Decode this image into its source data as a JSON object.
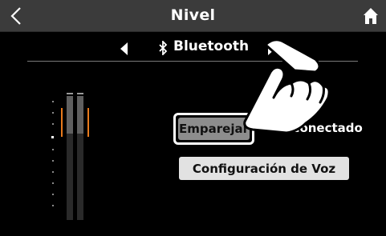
{
  "header": {
    "title": "Nivel",
    "back_icon": "chevron-left-icon",
    "home_icon": "home-icon"
  },
  "source": {
    "label": "Bluetooth",
    "icon": "bluetooth-icon",
    "prev_icon": "triangle-left-icon",
    "next_icon": "triangle-right-icon"
  },
  "bluetooth": {
    "pair_label": "Emparejar",
    "status": "Desconectado",
    "voice_label": "Configuración de Voz"
  },
  "meters": {
    "left_level": 0.3,
    "right_level": 0.3,
    "lit_color": "#5f5f5f",
    "peak_color": "#e87a1c"
  },
  "colors": {
    "background": "#000000",
    "topbar": "#3b3b3b",
    "button_light": "#e2e2e2",
    "button_selected": "#8d8d8d"
  },
  "overlay": {
    "icon": "pointing-hand-icon"
  }
}
